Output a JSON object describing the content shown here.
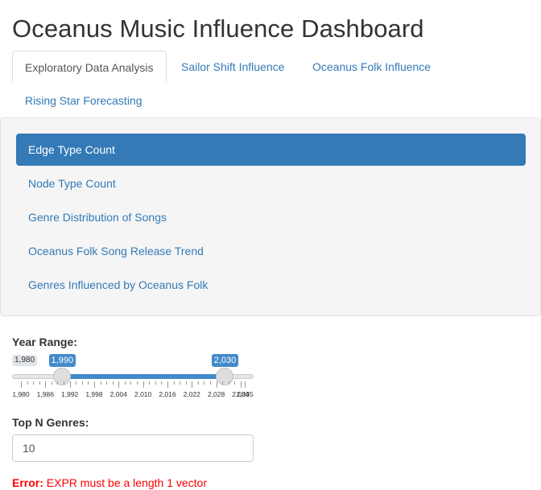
{
  "title": "Oceanus Music Influence Dashboard",
  "tabs": [
    {
      "label": "Exploratory Data Analysis",
      "active": true
    },
    {
      "label": "Sailor Shift Influence",
      "active": false
    },
    {
      "label": "Oceanus Folk Influence",
      "active": false
    },
    {
      "label": "Rising Star Forecasting",
      "active": false
    }
  ],
  "nav_pills": [
    {
      "label": "Edge Type Count",
      "active": true
    },
    {
      "label": "Node Type Count",
      "active": false
    },
    {
      "label": "Genre Distribution of Songs",
      "active": false
    },
    {
      "label": "Oceanus Folk Song Release Trend",
      "active": false
    },
    {
      "label": "Genres Influenced by Oceanus Folk",
      "active": false
    }
  ],
  "year_range": {
    "label": "Year Range:",
    "min_label": "1,980",
    "from_label": "1,990",
    "to_label": "2,030",
    "min": 1980,
    "max": 2035,
    "from": 1990,
    "to": 2030,
    "grid_labels": [
      "1,980",
      "1,986",
      "1,992",
      "1,998",
      "2,004",
      "2,010",
      "2,016",
      "2,022",
      "2,028",
      "2,034",
      "2,035"
    ],
    "grid_values": [
      1980,
      1986,
      1992,
      1998,
      2004,
      2010,
      2016,
      2022,
      2028,
      2034,
      2035
    ]
  },
  "top_n": {
    "label": "Top N Genres:",
    "value": "10"
  },
  "error": {
    "prefix": "Error:",
    "message": " EXPR must be a length 1 vector"
  },
  "colors": {
    "accent": "#337ab7",
    "slider_bar": "#428bca",
    "error": "#ff0000"
  }
}
